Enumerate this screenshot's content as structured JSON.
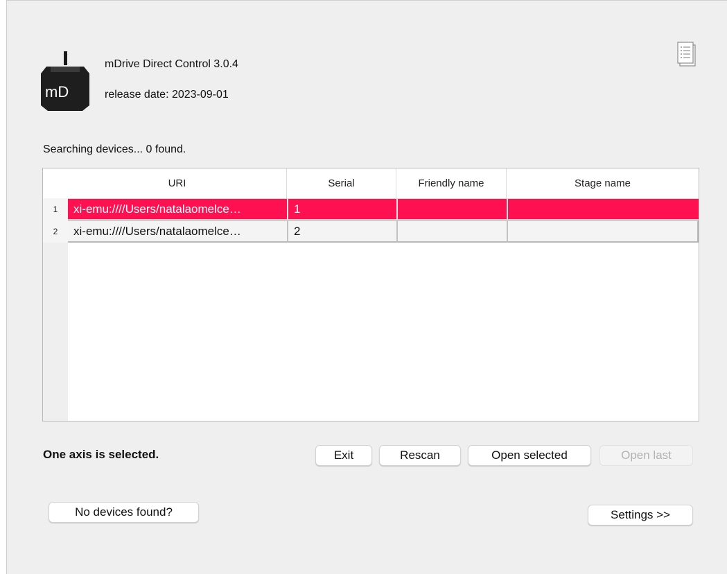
{
  "app": {
    "title": "mDrive Direct Control 3.0.4",
    "release_date": "release date: 2023-09-01",
    "logo_text": "mD"
  },
  "search_status": "Searching devices... 0 found.",
  "table": {
    "columns": [
      "URI",
      "Serial",
      "Friendly name",
      "Stage name"
    ],
    "rows": [
      {
        "num": "1",
        "uri": "xi-emu:////Users/natalaomelce…",
        "serial": "1",
        "friendly": "",
        "stage": "",
        "selected": true
      },
      {
        "num": "2",
        "uri": "xi-emu:////Users/natalaomelce…",
        "serial": "2",
        "friendly": "",
        "stage": "",
        "selected": false
      }
    ]
  },
  "axis_status": "One axis is selected.",
  "buttons": {
    "exit": "Exit",
    "rescan": "Rescan",
    "open_selected": "Open selected",
    "open_last": "Open last",
    "no_devices": "No devices found?",
    "settings": "Settings >>"
  },
  "icons": {
    "logo": "mdrive-logo",
    "log": "log-document-icon"
  },
  "colors": {
    "selection": "#ff1050",
    "window_bg": "#efefef"
  }
}
